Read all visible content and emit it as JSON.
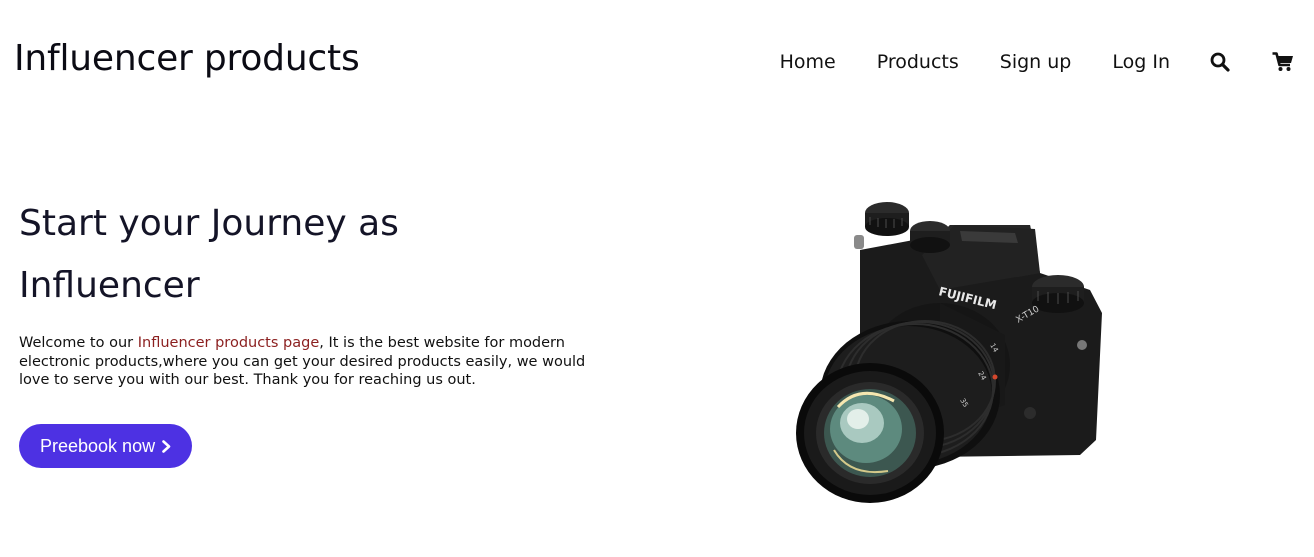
{
  "header": {
    "logo": "Influencer products",
    "nav": [
      {
        "label": "Home"
      },
      {
        "label": "Products"
      },
      {
        "label": "Sign up"
      },
      {
        "label": "Log In"
      }
    ],
    "icons": {
      "search": "search-icon",
      "cart": "cart-icon"
    }
  },
  "hero": {
    "title_line1": "Start your Journey as",
    "title_line2": "Influencer",
    "text_before": "Welcome to our ",
    "text_highlight": "Influencer products page",
    "text_after": ", It is the best website for modern electronic products,where you can get your desired products easily, we would love to serve you with our best. Thank you for reaching us out.",
    "button_label": "Preebook now",
    "image": {
      "icon": "camera-image",
      "brand": "FUJIFILM",
      "model": "X-T10"
    }
  },
  "colors": {
    "accent": "#4d31e3",
    "highlight": "#8b1f1f",
    "text": "#111111"
  }
}
